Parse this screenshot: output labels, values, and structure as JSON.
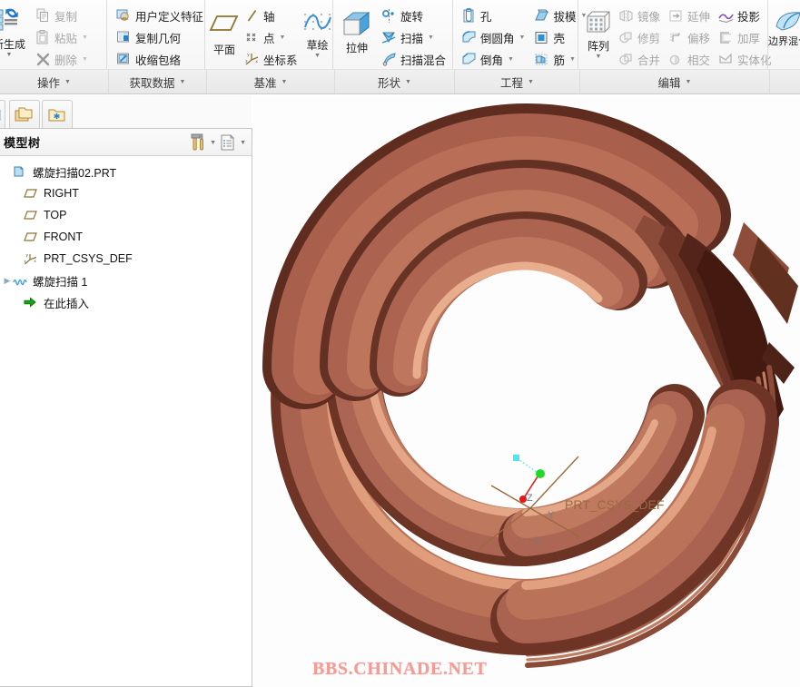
{
  "ribbon": {
    "groups": [
      {
        "label": "操作",
        "big": [
          {
            "label": "新生成",
            "icon": "regenerate-icon",
            "has_caret": true
          }
        ],
        "items": [
          {
            "label": "复制",
            "icon": "copy-icon",
            "disabled": true,
            "caret": false
          },
          {
            "label": "粘贴",
            "icon": "paste-icon",
            "disabled": true,
            "caret": true
          },
          {
            "label": "删除",
            "icon": "delete-icon",
            "disabled": true,
            "caret": true
          }
        ]
      },
      {
        "label": "获取数据",
        "items": [
          {
            "label": "用户定义特征",
            "icon": "udf-icon",
            "disabled": false,
            "caret": false
          },
          {
            "label": "复制几何",
            "icon": "copy-geometry-icon",
            "disabled": false,
            "caret": false
          },
          {
            "label": "收缩包络",
            "icon": "shrinkwrap-icon",
            "disabled": false,
            "caret": false
          }
        ]
      },
      {
        "label": "基准",
        "big": [
          {
            "label": "平面",
            "icon": "datum-plane-icon",
            "has_caret": false
          }
        ],
        "items": [
          {
            "label": "轴",
            "icon": "datum-axis-icon",
            "disabled": false,
            "caret": false
          },
          {
            "label": "点",
            "icon": "datum-point-icon",
            "disabled": false,
            "caret": true
          },
          {
            "label": "坐标系",
            "icon": "datum-csys-icon",
            "disabled": false,
            "caret": false
          }
        ],
        "big2": [
          {
            "label": "草绘",
            "icon": "sketch-icon",
            "has_caret": true
          }
        ]
      },
      {
        "label": "形状",
        "big": [
          {
            "label": "拉伸",
            "icon": "extrude-icon",
            "has_caret": false
          }
        ],
        "items": [
          {
            "label": "旋转",
            "icon": "revolve-icon",
            "disabled": false,
            "caret": false
          },
          {
            "label": "扫描",
            "icon": "sweep-icon",
            "disabled": false,
            "caret": true
          },
          {
            "label": "扫描混合",
            "icon": "swept-blend-icon",
            "disabled": false,
            "caret": false
          }
        ]
      },
      {
        "label": "工程",
        "items": [
          {
            "label": "孔",
            "icon": "hole-icon",
            "disabled": false,
            "caret": false
          },
          {
            "label": "倒圆角",
            "icon": "round-icon",
            "disabled": false,
            "caret": true
          },
          {
            "label": "倒角",
            "icon": "chamfer-icon",
            "disabled": false,
            "caret": true
          }
        ],
        "items2": [
          {
            "label": "拔模",
            "icon": "draft-icon",
            "disabled": false,
            "caret": true
          },
          {
            "label": "壳",
            "icon": "shell-icon",
            "disabled": false,
            "caret": false
          },
          {
            "label": "筋",
            "icon": "rib-icon",
            "disabled": false,
            "caret": true
          }
        ]
      },
      {
        "label": "编辑",
        "big": [
          {
            "label": "阵列",
            "icon": "pattern-icon",
            "has_caret": true
          }
        ],
        "items": [
          {
            "label": "镜像",
            "icon": "mirror-icon",
            "disabled": true,
            "caret": false
          },
          {
            "label": "修剪",
            "icon": "trim-icon",
            "disabled": true,
            "caret": false
          },
          {
            "label": "合并",
            "icon": "merge-icon",
            "disabled": true,
            "caret": false
          }
        ],
        "items2": [
          {
            "label": "延伸",
            "icon": "extend-icon",
            "disabled": true,
            "caret": false
          },
          {
            "label": "偏移",
            "icon": "offset-icon",
            "disabled": true,
            "caret": false
          },
          {
            "label": "相交",
            "icon": "intersect-icon",
            "disabled": true,
            "caret": false
          }
        ],
        "items3": [
          {
            "label": "投影",
            "icon": "project-icon",
            "disabled": false,
            "caret": false
          },
          {
            "label": "加厚",
            "icon": "thicken-icon",
            "disabled": true,
            "caret": false
          },
          {
            "label": "实体化",
            "icon": "solidify-icon",
            "disabled": true,
            "caret": false
          }
        ]
      },
      {
        "label": "",
        "big": [
          {
            "label": "边界混合",
            "icon": "boundary-blend-icon",
            "has_caret": false
          }
        ],
        "items": []
      }
    ]
  },
  "navigator": {
    "tabs": [
      {
        "name": "tab-partial",
        "icon": "partial-tab-icon"
      },
      {
        "name": "tab-folders",
        "icon": "folder-browser-icon"
      },
      {
        "name": "tab-favorites",
        "icon": "favorites-folder-icon"
      }
    ]
  },
  "model_tree": {
    "title": "模型树",
    "tools": [
      {
        "name": "settings-tools-button",
        "icon": "hammer-screwdriver-icon",
        "caret": true
      },
      {
        "name": "tree-display-button",
        "icon": "list-settings-icon",
        "caret": true
      }
    ],
    "items": [
      {
        "label": "螺旋扫描02.PRT",
        "icon": "part-icon",
        "depth": 0,
        "expander": ""
      },
      {
        "label": "RIGHT",
        "icon": "datum-plane-icon",
        "depth": 1,
        "expander": ""
      },
      {
        "label": "TOP",
        "icon": "datum-plane-icon",
        "depth": 1,
        "expander": ""
      },
      {
        "label": "FRONT",
        "icon": "datum-plane-icon",
        "depth": 1,
        "expander": ""
      },
      {
        "label": "PRT_CSYS_DEF",
        "icon": "csys-icon",
        "depth": 1,
        "expander": ""
      },
      {
        "label": "螺旋扫描 1",
        "icon": "helical-sweep-icon",
        "depth": 1,
        "expander": "▶"
      },
      {
        "label": "在此插入",
        "icon": "insert-here-icon",
        "depth": 1,
        "expander": ""
      }
    ]
  },
  "viewport": {
    "csys_label": "PRT_CSYS_DEF",
    "axis_labels": {
      "x": "X",
      "y": "Y",
      "z": "Z"
    },
    "watermark": "BBS.CHINADE.NET",
    "colors": {
      "model_base": "#b06a56",
      "model_light": "#e8a489",
      "model_dark": "#5e2c20",
      "background": "#fdfdfd",
      "csys_brown": "#9a6a3c",
      "drag_green": "#22d82b",
      "drag_red": "#e01b1b",
      "drag_cyan": "#49e8f0",
      "watermark_color": "#f79a94"
    }
  }
}
